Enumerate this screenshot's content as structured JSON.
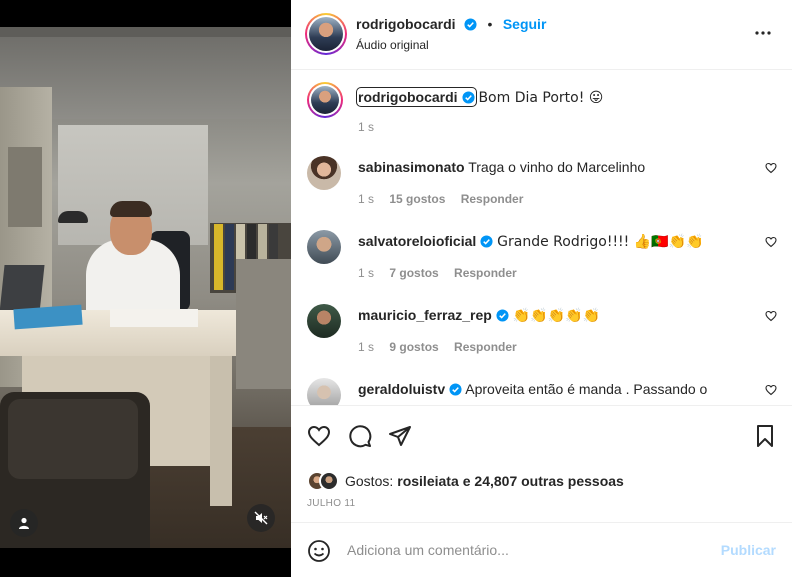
{
  "post": {
    "author": "rodrigobocardi",
    "follow_label": "Seguir",
    "dot": "•",
    "audio": "Áudio original",
    "more_icon": "more-horizontal-icon"
  },
  "caption": {
    "username": "rodrigobocardi",
    "text": "Bom Dia Porto! 😛",
    "time": "1 s"
  },
  "comments": [
    {
      "username": "sabinasimonato",
      "text": "Traga o vinho do Marcelinho",
      "time": "1 s",
      "likes": "15 gostos",
      "reply": "Responder"
    },
    {
      "username": "salvatoreloioficial",
      "text": "Grande Rodrigo!!!! 👍🇵🇹👏👏",
      "time": "1 s",
      "likes": "7 gostos",
      "reply": "Responder"
    },
    {
      "username": "mauricio_ferraz_rep",
      "text": "👏👏👏👏👏",
      "time": "1 s",
      "likes": "9 gostos",
      "reply": "Responder"
    },
    {
      "username": "geraldoluistv",
      "text": "Aproveita então é manda . Passando o",
      "time": "",
      "likes": "",
      "reply": ""
    }
  ],
  "likes": {
    "prefix": "Gostos:",
    "user": "rosileiata",
    "suffix": "e 24,807 outras pessoas"
  },
  "date": "JULHO 11",
  "composer": {
    "placeholder": "Adiciona um comentário...",
    "publish_label": "Publicar"
  },
  "colors": {
    "accent": "#0095f6",
    "verified": "#0095f6",
    "muted": "#8e8e8e",
    "publish_disabled": "#b3dbff"
  }
}
